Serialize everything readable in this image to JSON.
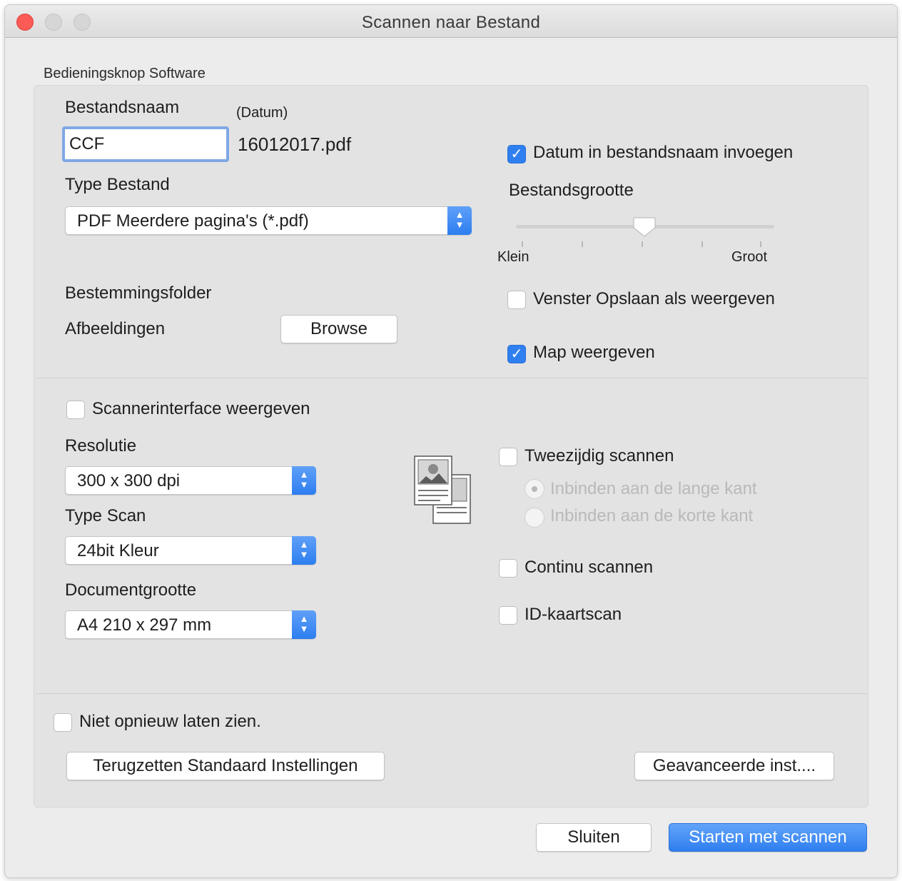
{
  "window": {
    "title": "Scannen naar Bestand"
  },
  "group_label": "Bedieningsknop Software",
  "file_name": {
    "label": "Bestandsnaam",
    "date_hint": "(Datum)",
    "value": "CCF",
    "suffix": "16012017.pdf"
  },
  "file_type": {
    "label": "Type Bestand",
    "selected": "PDF Meerdere pagina's (*.pdf)"
  },
  "date_checkbox": {
    "label": "Datum in bestandsnaam invoegen",
    "checked": true
  },
  "file_size": {
    "label": "Bestandsgrootte",
    "min_label": "Klein",
    "max_label": "Groot",
    "level": 0.5
  },
  "destination": {
    "label": "Bestemmingsfolder",
    "folder": "Afbeeldingen",
    "browse_label": "Browse"
  },
  "save_as_checkbox": {
    "label": "Venster Opslaan als weergeven",
    "checked": false
  },
  "show_folder_checkbox": {
    "label": "Map weergeven",
    "checked": true
  },
  "scanner_interface_checkbox": {
    "label": "Scannerinterface weergeven",
    "checked": false
  },
  "resolution": {
    "label": "Resolutie",
    "selected": "300 x 300 dpi"
  },
  "scan_type": {
    "label": "Type Scan",
    "selected": "24bit Kleur"
  },
  "document_size": {
    "label": "Documentgrootte",
    "selected": "A4 210 x 297 mm"
  },
  "duplex": {
    "label": "Tweezijdig scannen",
    "checked": false,
    "long_edge_label": "Inbinden aan de lange kant",
    "short_edge_label": "Inbinden aan de korte kant"
  },
  "continuous_checkbox": {
    "label": "Continu scannen",
    "checked": false
  },
  "id_card_checkbox": {
    "label": "ID-kaartscan",
    "checked": false
  },
  "dont_show_checkbox": {
    "label": "Niet opnieuw laten zien.",
    "checked": false
  },
  "buttons": {
    "reset_label": "Terugzetten Standaard Instellingen",
    "advanced_label": "Geavanceerde inst....",
    "close_label": "Sluiten",
    "start_label": "Starten met scannen"
  },
  "colors": {
    "accent": "#2f7ff0",
    "close_light": "#fc5a55",
    "panel_bg": "#e3e3e3",
    "window_bg": "#ececec"
  },
  "icons": [
    "close-icon",
    "minimize-icon",
    "maximize-icon",
    "checkmark-icon",
    "popup-arrows-icon",
    "duplex-document-icon"
  ]
}
